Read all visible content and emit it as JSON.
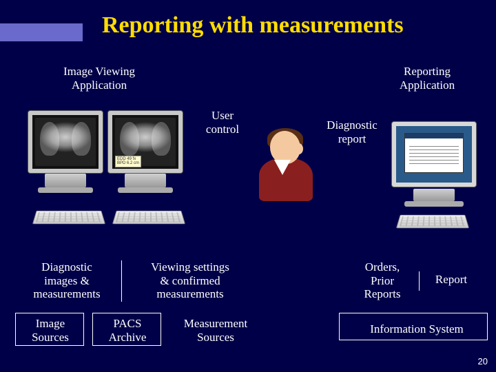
{
  "title": "Reporting with measurements",
  "labels": {
    "imgViewApp": "Image Viewing\nApplication",
    "reportingApp": "Reporting\nApplication",
    "userControl": "User\ncontrol",
    "diagReport": "Diagnostic\nreport",
    "diagImages": "Diagnostic\nimages &\nmeasurements",
    "viewSettings": "Viewing settings\n& confirmed\nmeasurements",
    "orders": "Orders,\nPrior\nReports",
    "report": "Report",
    "imageSources": "Image\nSources",
    "pacsArchive": "PACS\nArchive",
    "measSources": "Measurement\nSources",
    "infoSystem": "Information System"
  },
  "measurements": {
    "line1": "EDD 49 fx",
    "line2": "BPD 6.2 cm"
  },
  "slideNumber": "20"
}
